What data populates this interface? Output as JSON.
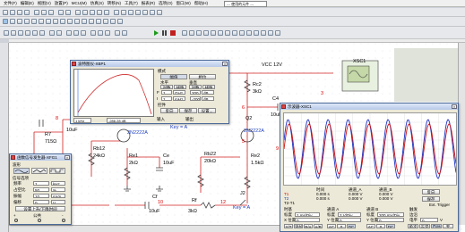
{
  "menu": [
    "文件(F)",
    "编辑(E)",
    "视图(V)",
    "放置(P)",
    "MCU(M)",
    "仿真(S)",
    "转移(N)",
    "工具(T)",
    "报表(R)",
    "选项(O)",
    "窗口(W)",
    "帮助(H)"
  ],
  "toolbar": {
    "component_list": "--- 使用的元件 ---"
  },
  "circuit": {
    "vcc": "VCC 12V",
    "rc2": "Rc2",
    "rc2_val": "3kΩ",
    "c4": "C4",
    "c4_val": "10uF",
    "q2": "Q2",
    "q2_model": "2N2222A",
    "key_a1": "Key = A",
    "key_a2": "Key = A",
    "q1_model": "2N2222A",
    "r7": "R7",
    "r7_val": "715Ω",
    "c_left_val": "10uF",
    "rb12": "Rb12",
    "rb12_val": "24kΩ",
    "re1": "Re1",
    "re1_val": "2kΩ",
    "ce": "Ce",
    "ce_val": "10uF",
    "rb22": "Rb22",
    "rb22_val": "20kΩ",
    "re2": "Re2",
    "re2_val": "1.5kΩ",
    "cf": "Cf",
    "cf_val": "10uF",
    "rf": "Rf",
    "rf_val": "3kΩ",
    "j2": "J2",
    "xsc1": "XSC1",
    "net_8": "8",
    "net_3": "3",
    "net_9": "9",
    "net_6": "6",
    "net_5": "5",
    "net_10": "10",
    "net_12": "12",
    "net_2": "2"
  },
  "bode": {
    "title": "波特图仪-XBP1",
    "mode_label": "模式",
    "mode_btn1": "幅值",
    "mode_btn2": "相位",
    "horiz_label": "水平",
    "vert_label": "垂直",
    "log_btn": "对数",
    "lin_btn": "线性",
    "f_label": "F",
    "f_val": "1",
    "f_unit": "GHz",
    "i_label": "I",
    "i_val": "1",
    "i_unit": "mHz",
    "vf_val": "200",
    "vi_val": "-200",
    "vf_unit": "dB",
    "vi_unit": "dB",
    "control_label": "控件",
    "reverse_btn": "反向",
    "save_btn": "保存",
    "set_btn": "设置...",
    "freq_readout": "1 kHz",
    "db_readout": "-286.28 dB",
    "in_label": "输入",
    "out_label": "输出"
  },
  "scope": {
    "title": "示波器-XSC1",
    "t_col": "时间",
    "cha_col": "通道_A",
    "chb_col": "通道_B",
    "t1_label": "T1",
    "t2_label": "T2",
    "t2t1_label": "T2-T1",
    "t1_time": "0.000 s",
    "t1_a": "0.000 V",
    "t1_b": "0.000 V",
    "t2_time": "0.000 s",
    "t2_a": "0.000 V",
    "t2_b": "0.000 V",
    "reverse_btn": "反向",
    "save_btn": "保存",
    "ext_trigger": "Ext. Trigger",
    "timebase_label": "时基",
    "scale_label": "标度",
    "scale_val": "1 ms/Div",
    "xpos_label": "X 位置",
    "xpos_val": "0",
    "cha_label": "通道 A",
    "cha_scale": "2 V/Div",
    "ypos_a_label": "Y 位置",
    "ypos_a_val": "0",
    "chb_label": "通道 B",
    "chb_scale": "200 mV/Div",
    "ypos_b_label": "Y 位置",
    "ypos_b_val": "0",
    "trigger_label": "触发",
    "edge_label": "边沿",
    "level_label": "电平",
    "level_val": "0",
    "level_unit": "V",
    "mode_yt": "Y/T",
    "mode_add": "添加",
    "mode_ba": "B/A",
    "mode_ab": "A/B",
    "ac": "AC",
    "zero": "0",
    "dc": "DC",
    "single": "单次",
    "normal": "正常",
    "auto": "自动",
    "none": "无",
    "ext": "外触发",
    "cha_color": "#d01010",
    "chb_color": "#2030c0"
  },
  "fgen": {
    "title": "函数信号发生器-XFG1",
    "wave_label": "波形",
    "signal_label": "信号选项",
    "freq_label": "频率",
    "freq_val": "1",
    "freq_unit": "kHz",
    "duty_label": "占空比",
    "duty_val": "50",
    "duty_unit": "%",
    "amp_label": "振幅",
    "amp_val": "10",
    "amp_unit": "mVp",
    "offset_label": "偏移",
    "offset_val": "0",
    "offset_unit": "V",
    "set_rise": "设置上升/下降时间",
    "common_label": "公共",
    "plus": "+",
    "minus": "-"
  }
}
